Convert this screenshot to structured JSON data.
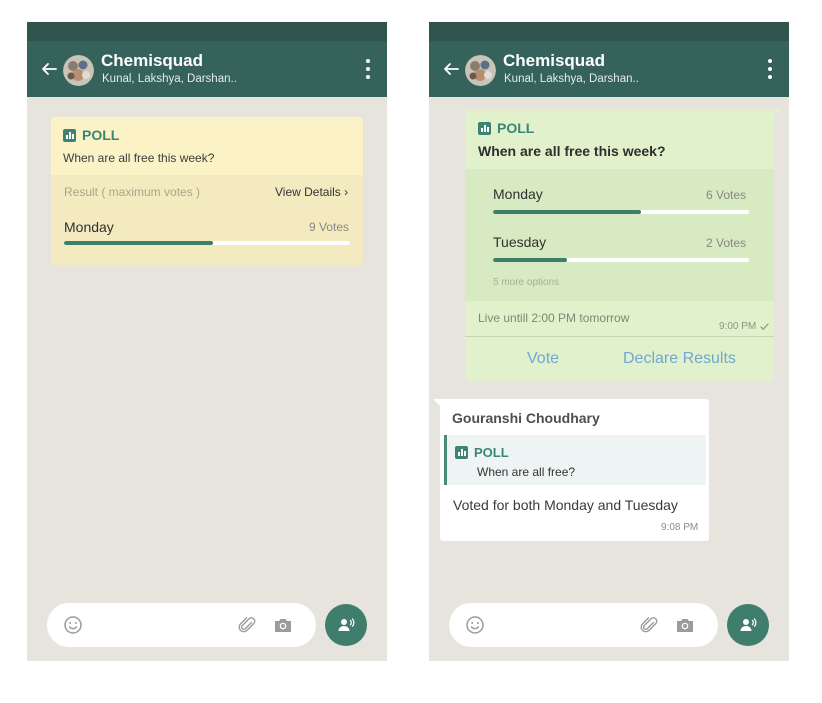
{
  "colors": {
    "app_bar": "#35625a",
    "status_bar": "#2e544b",
    "chat_background": "#e7e3dd",
    "poll_accent": "#3f7d6d",
    "left_poll_background": "#fbf2c6",
    "right_poll_background": "#e0f1cc",
    "action_text": "#6fa8d2"
  },
  "left": {
    "header": {
      "title": "Chemisquad",
      "subtitle": "Kunal, Lakshya, Darshan..",
      "back_icon": "arrow-left",
      "menu_icon": "more-vertical"
    },
    "poll": {
      "label": "POLL",
      "icon": "bar-chart",
      "question": "When are all free this week?",
      "result_label": "Result ( maximum votes )",
      "view_details": "View Details",
      "options": [
        {
          "name": "Monday",
          "votes": "9 Votes",
          "share": 0.52
        }
      ]
    },
    "input_bar": {
      "emoji_icon": "smiley",
      "attach_icon": "paperclip",
      "camera_icon": "camera",
      "mic_icon": "voice-record"
    }
  },
  "right": {
    "header": {
      "title": "Chemisquad",
      "subtitle": "Kunal, Lakshya, Darshan..",
      "back_icon": "arrow-left",
      "menu_icon": "more-vertical"
    },
    "poll": {
      "label": "POLL",
      "icon": "bar-chart",
      "question": "When are all free this week?",
      "options": [
        {
          "name": "Monday",
          "votes": "6 Votes",
          "share": 0.58
        },
        {
          "name": "Tuesday",
          "votes": "2 Votes",
          "share": 0.29
        }
      ],
      "more_options": "5 more options",
      "live_until": "Live untill 2:00 PM tomorrow",
      "time": "9:00 PM",
      "actions": {
        "vote": "Vote",
        "declare": "Declare Results"
      }
    },
    "reply": {
      "sender": "Gouranshi Choudhary",
      "quoted_label": "POLL",
      "quoted_question": "When are all free?",
      "text": "Voted for both Monday and Tuesday",
      "time": "9:08 PM"
    },
    "input_bar": {
      "emoji_icon": "smiley",
      "attach_icon": "paperclip",
      "camera_icon": "camera",
      "mic_icon": "voice-record"
    }
  }
}
